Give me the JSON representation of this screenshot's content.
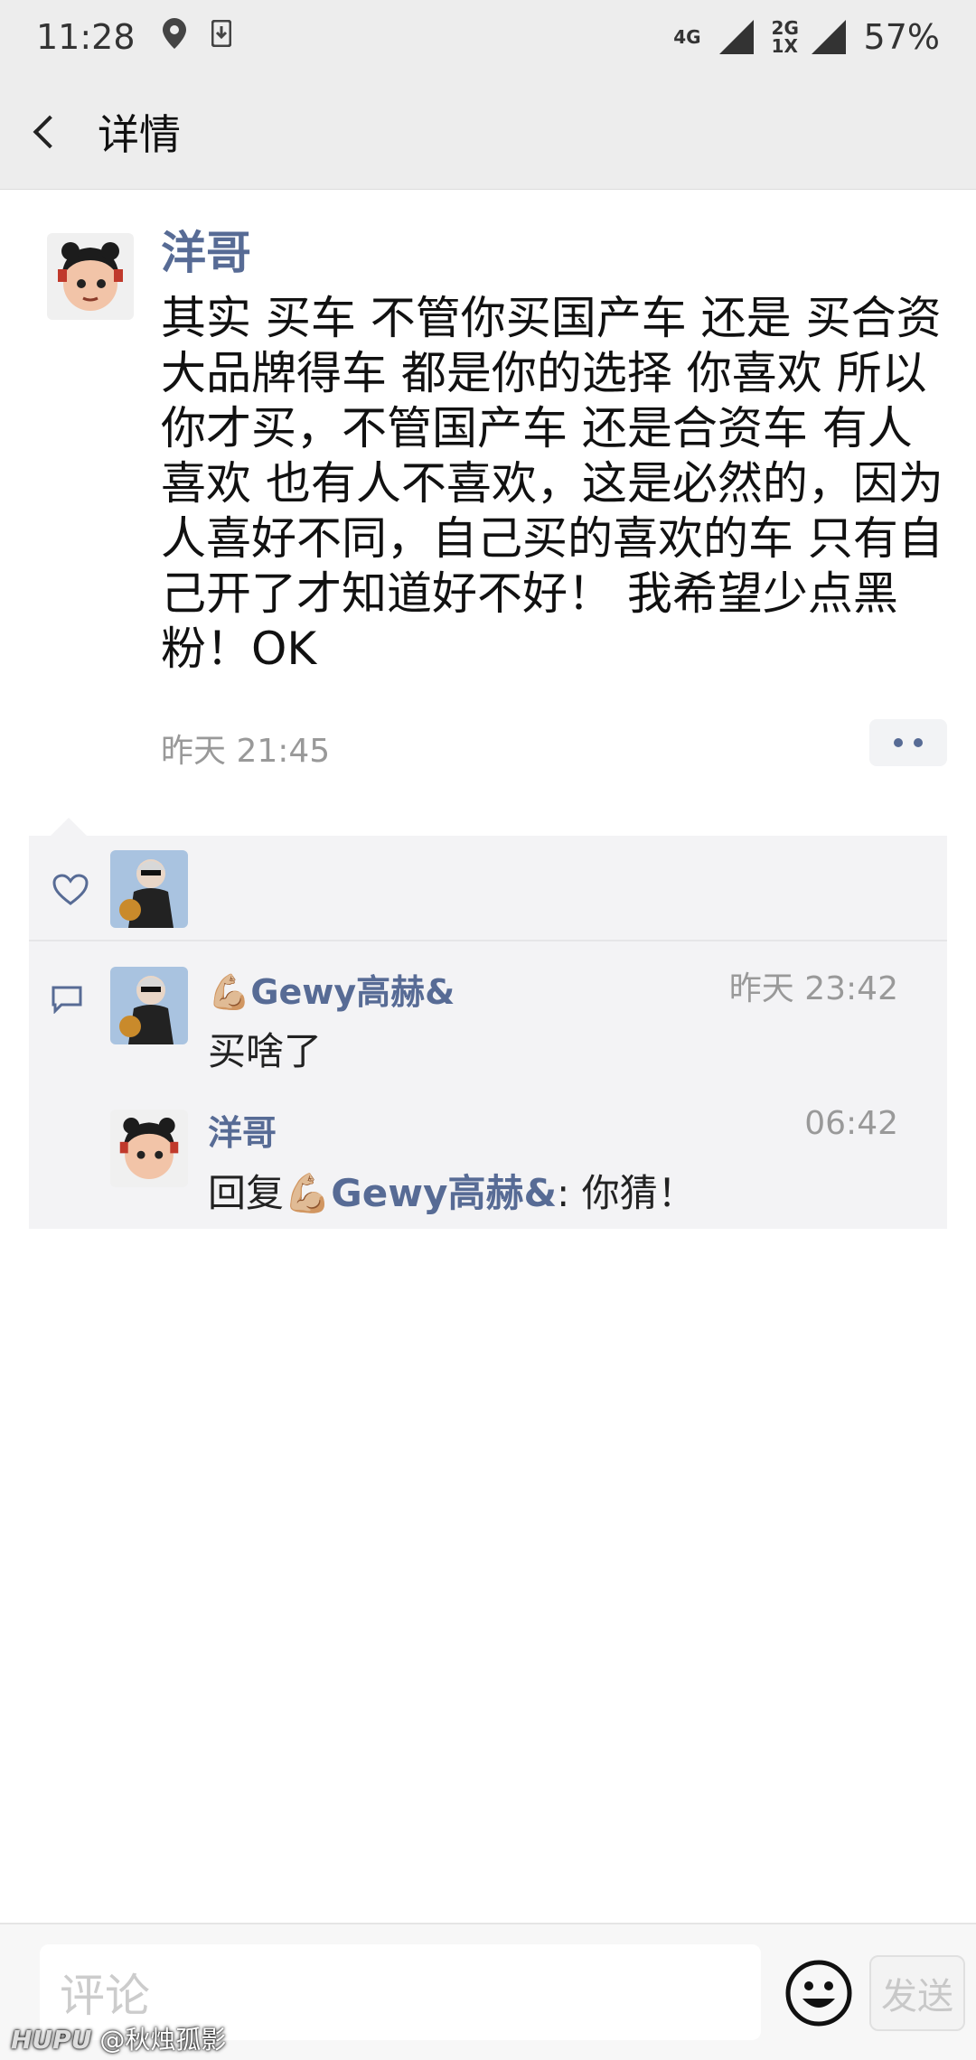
{
  "status_bar": {
    "time": "11:28",
    "network_top": "4G",
    "network_bottom": "2G 1X",
    "battery": "57%"
  },
  "header": {
    "title": "详情"
  },
  "post": {
    "author": "洋哥",
    "text": "其实 买车 不管你买国产车 还是 买合资大品牌得车 都是你的选择 你喜欢 所以你才买，不管国产车 还是合资车 有人喜欢 也有人不喜欢，这是必然的，因为人喜好不同，自己买的喜欢的车 只有自己开了才知道好不好！ 我希望少点黑粉！OK",
    "time": "昨天 21:45"
  },
  "comments": [
    {
      "name": "💪🏼Gewy高赫&",
      "time": "昨天 23:42",
      "text": "买啥了"
    },
    {
      "name": "洋哥",
      "time": "06:42",
      "reply_prefix": "回复",
      "reply_target": "💪🏼Gewy高赫&",
      "reply_text": ": 你猜！"
    }
  ],
  "footer": {
    "input_placeholder": "评论",
    "send_label": "发送"
  },
  "watermark": {
    "brand": "HUPU",
    "handle": "@秋烛孤影"
  },
  "colors": {
    "link_blue": "#576b95",
    "header_bg": "#ededed",
    "panel_bg": "#f3f3f5"
  }
}
